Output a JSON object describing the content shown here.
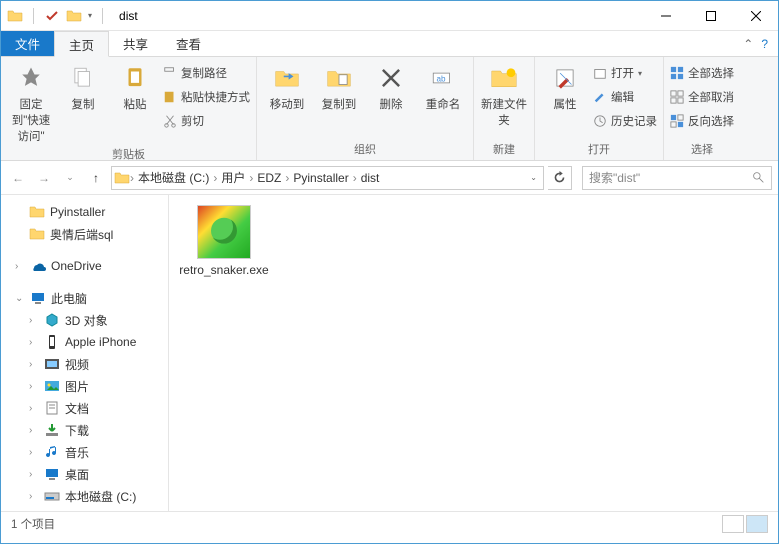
{
  "window": {
    "title": "dist"
  },
  "tabs": {
    "file": "文件",
    "home": "主页",
    "share": "共享",
    "view": "查看"
  },
  "ribbon": {
    "pin": "固定到\"快速访问\"",
    "copy": "复制",
    "paste": "粘贴",
    "copy_path": "复制路径",
    "paste_shortcut": "粘贴快捷方式",
    "cut": "剪切",
    "clipboard": "剪贴板",
    "move_to": "移动到",
    "copy_to": "复制到",
    "delete": "删除",
    "rename": "重命名",
    "organize": "组织",
    "new_folder": "新建文件夹",
    "new": "新建",
    "properties": "属性",
    "open": "打开",
    "edit": "编辑",
    "history": "历史记录",
    "open_group": "打开",
    "select_all": "全部选择",
    "select_none": "全部取消",
    "invert": "反向选择",
    "select": "选择"
  },
  "breadcrumb": [
    "本地磁盘 (C:)",
    "用户",
    "EDZ",
    "Pyinstaller",
    "dist"
  ],
  "search_placeholder": "搜索\"dist\"",
  "tree": {
    "pyinstaller": "Pyinstaller",
    "sql_folder": "奥情后端sql",
    "onedrive": "OneDrive",
    "this_pc": "此电脑",
    "objects_3d": "3D 对象",
    "iphone": "Apple iPhone",
    "videos": "视频",
    "pictures": "图片",
    "documents": "文档",
    "downloads": "下载",
    "music": "音乐",
    "desktop": "桌面",
    "c_drive": "本地磁盘 (C:)"
  },
  "content": {
    "file1": "retro_snaker.exe"
  },
  "status": {
    "count": "1 个项目"
  }
}
